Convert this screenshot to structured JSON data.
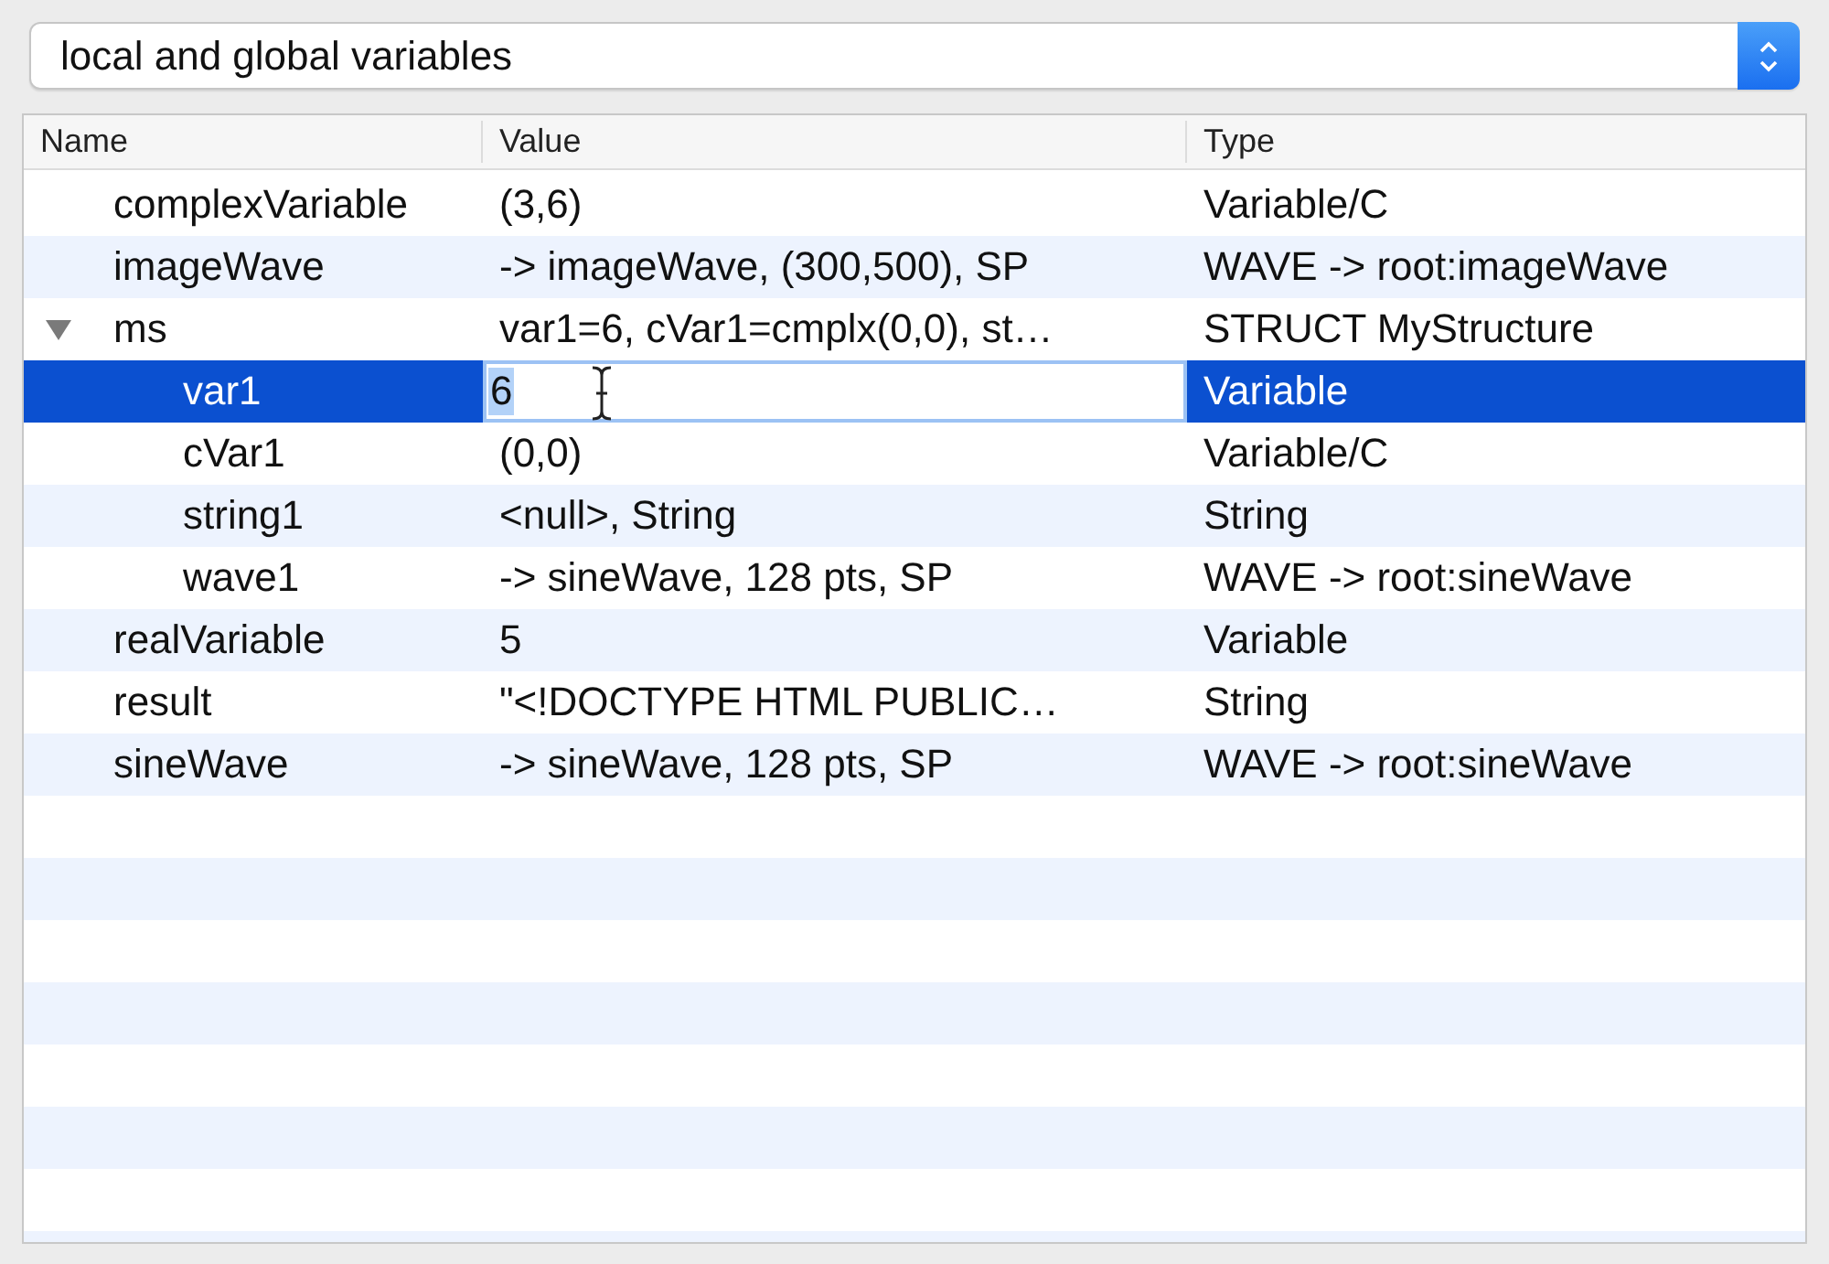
{
  "scope_popup": {
    "value": "local and global variables"
  },
  "table": {
    "columns": [
      "Name",
      "Value",
      "Type"
    ],
    "rows": [
      {
        "name": "complexVariable",
        "value": "(3,6)",
        "type": "Variable/C",
        "selected": false
      },
      {
        "name": "imageWave",
        "value": "-> imageWave, (300,500), SP",
        "type": "WAVE -> root:imageWave",
        "selected": false
      },
      {
        "name": "ms",
        "value": "var1=6, cVar1=cmplx(0,0), st…",
        "type": "STRUCT MyStructure",
        "selected": false,
        "expanded": true,
        "children": [
          {
            "name": "var1",
            "value": "6",
            "type": "Variable",
            "selected": true,
            "editing": true
          },
          {
            "name": "cVar1",
            "value": "(0,0)",
            "type": "Variable/C",
            "selected": false
          },
          {
            "name": "string1",
            "value": "<null>, String",
            "type": "String",
            "selected": false
          },
          {
            "name": "wave1",
            "value": "-> sineWave, 128 pts, SP",
            "type": "WAVE -> root:sineWave",
            "selected": false
          }
        ]
      },
      {
        "name": "realVariable",
        "value": "5",
        "type": "Variable",
        "selected": false
      },
      {
        "name": "result",
        "value": "\"<!DOCTYPE HTML PUBLIC…",
        "type": "String",
        "selected": false
      },
      {
        "name": "sineWave",
        "value": "-> sineWave, 128 pts, SP",
        "type": "WAVE -> root:sineWave",
        "selected": false
      }
    ]
  }
}
